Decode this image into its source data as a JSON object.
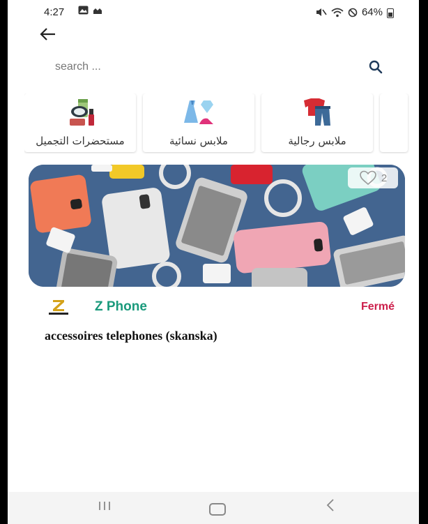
{
  "status_bar": {
    "time": "4:27",
    "battery": "64%",
    "icons": [
      "image-icon",
      "app-icon",
      "mute-icon",
      "wifi-icon",
      "dnd-icon",
      "battery-icon"
    ]
  },
  "search": {
    "placeholder": "search ..."
  },
  "categories": [
    {
      "label": "مستحضرات التجميل",
      "icon": "cosmetics-icon"
    },
    {
      "label": "ملابس نسائية",
      "icon": "womens-clothing-icon"
    },
    {
      "label": "ملابس رجالية",
      "icon": "mens-clothing-icon"
    }
  ],
  "shop": {
    "name": "Z Phone",
    "status": "Fermé",
    "description": "accessoires telephones (skanska)",
    "likes": "2",
    "logo_text": "Z PHONE",
    "banner_image": "phones-accessories-photo"
  },
  "colors": {
    "shop_name": "#1a9a7c",
    "status_closed": "#cc1f4b"
  }
}
